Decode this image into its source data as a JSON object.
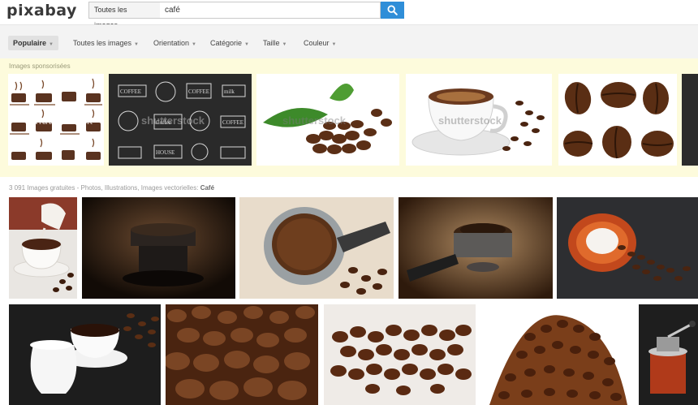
{
  "header": {
    "logo": "pixabay",
    "search_scope": "Toutes les images",
    "search_query": "café",
    "search_icon": "search-icon"
  },
  "filters": [
    {
      "label": "Populaire",
      "active": true
    },
    {
      "label": "Toutes les images",
      "active": false
    },
    {
      "label": "Orientation",
      "active": false
    },
    {
      "label": "Catégorie",
      "active": false
    },
    {
      "label": "Taille",
      "active": false
    },
    {
      "label": "Couleur",
      "active": false
    }
  ],
  "sponsored": {
    "label": "Images sponsorisées",
    "watermark": "shutterstock"
  },
  "results": {
    "count_text": "3 091 Images gratuites - Photos, Illustrations, Images vectorielles:",
    "query": "Café"
  },
  "colors": {
    "accent": "#2f8ed8",
    "sponsored_bg": "#fdfbdc",
    "filter_bg": "#f3f3f3"
  }
}
